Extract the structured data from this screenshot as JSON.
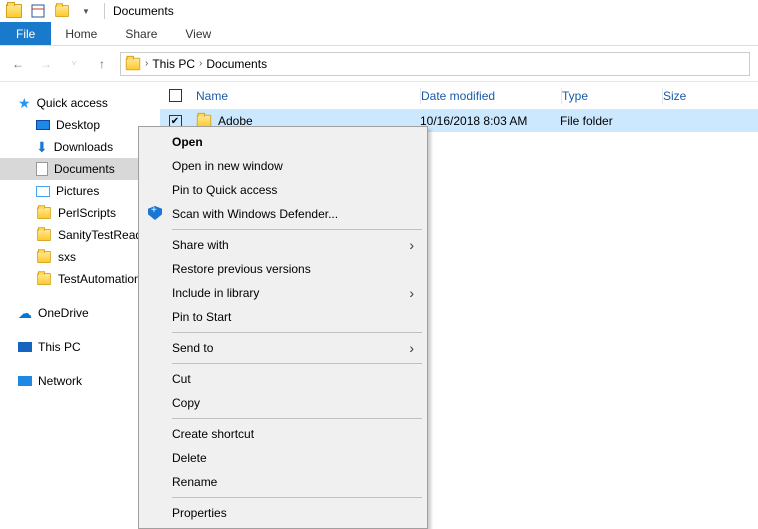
{
  "titlebar": {
    "title": "Documents"
  },
  "ribbon": {
    "file": "File",
    "home": "Home",
    "share": "Share",
    "view": "View"
  },
  "breadcrumb": {
    "seg1": "This PC",
    "seg2": "Documents"
  },
  "sidebar": {
    "quick_access": "Quick access",
    "desktop": "Desktop",
    "downloads": "Downloads",
    "documents": "Documents",
    "pictures": "Pictures",
    "perlscripts": "PerlScripts",
    "sanitytest": "SanityTestReady",
    "sxs": "sxs",
    "testauto": "TestAutomation",
    "onedrive": "OneDrive",
    "thispc": "This PC",
    "network": "Network"
  },
  "columns": {
    "name": "Name",
    "date": "Date modified",
    "type": "Type",
    "size": "Size"
  },
  "row": {
    "name": "Adobe",
    "date": "10/16/2018 8:03 AM",
    "type": "File folder"
  },
  "ctx": {
    "open": "Open",
    "open_new": "Open in new window",
    "pin_qa": "Pin to Quick access",
    "scan": "Scan with Windows Defender...",
    "share": "Share with",
    "restore": "Restore previous versions",
    "include": "Include in library",
    "pin_start": "Pin to Start",
    "sendto": "Send to",
    "cut": "Cut",
    "copy": "Copy",
    "shortcut": "Create shortcut",
    "delete": "Delete",
    "rename": "Rename",
    "properties": "Properties"
  }
}
